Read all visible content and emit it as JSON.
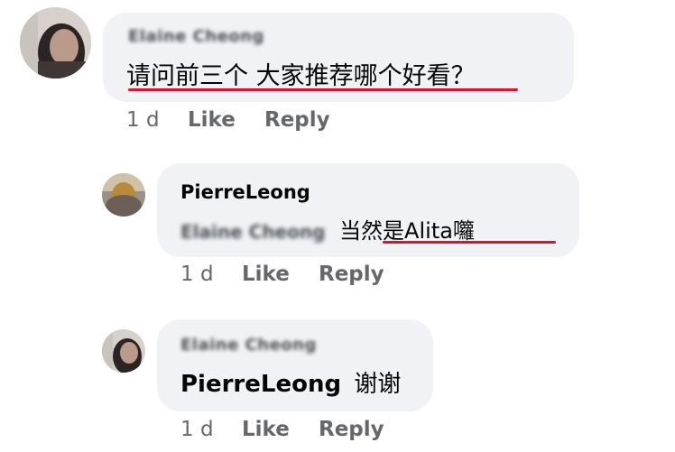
{
  "colors": {
    "bubble": "#f0f2f5",
    "underline": "#e0112b",
    "meta_text": "#65676b",
    "text": "#050505"
  },
  "comments": [
    {
      "author": "Elaine Cheong",
      "author_blurred": true,
      "text": "请问前三个 大家推荐哪个好看？",
      "time": "1 d",
      "like_label": "Like",
      "reply_label": "Reply"
    },
    {
      "author": "PierreLeong",
      "author_blurred": false,
      "mention": "Elaine Cheong",
      "mention_blurred": true,
      "text": "当然是Alita囖",
      "time": "1 d",
      "like_label": "Like",
      "reply_label": "Reply"
    },
    {
      "author": "Elaine Cheong",
      "author_blurred": true,
      "mention": "PierreLeong",
      "text": "谢谢",
      "time": "1 d",
      "like_label": "Like",
      "reply_label": "Reply"
    }
  ]
}
